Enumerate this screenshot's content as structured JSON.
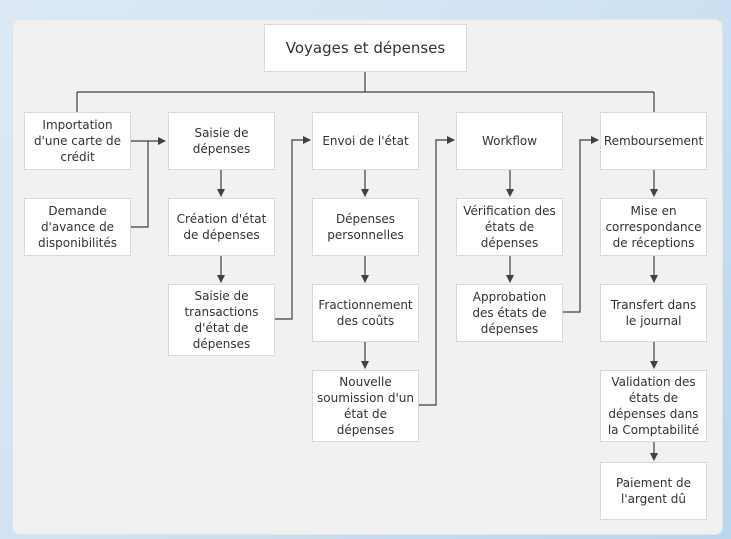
{
  "title": "Voyages et dépenses",
  "columns": [
    {
      "header": "Importation d'une carte de crédit",
      "items": [
        "Demande d'avance de disponibilités"
      ]
    },
    {
      "header": "Saisie de dépenses",
      "items": [
        "Création d'état de dépenses",
        "Saisie de transactions d'état de dépenses"
      ]
    },
    {
      "header": "Envoi de l'état",
      "items": [
        "Dépenses personnelles",
        "Fractionnement des coûts",
        "Nouvelle soumission d'un état de dépenses"
      ]
    },
    {
      "header": "Workflow",
      "items": [
        "Vérification des états de dépenses",
        "Approbation des états de dépenses"
      ]
    },
    {
      "header": "Remboursement",
      "items": [
        "Mise en correspondance de réceptions",
        "Transfert dans le journal",
        "Validation des états de dépenses dans la Comptabilité",
        "Paiement de l'argent dû"
      ]
    }
  ],
  "colors": {
    "line": "#404040",
    "box_border": "#d9d9d9",
    "panel": "#f1f1f1"
  }
}
